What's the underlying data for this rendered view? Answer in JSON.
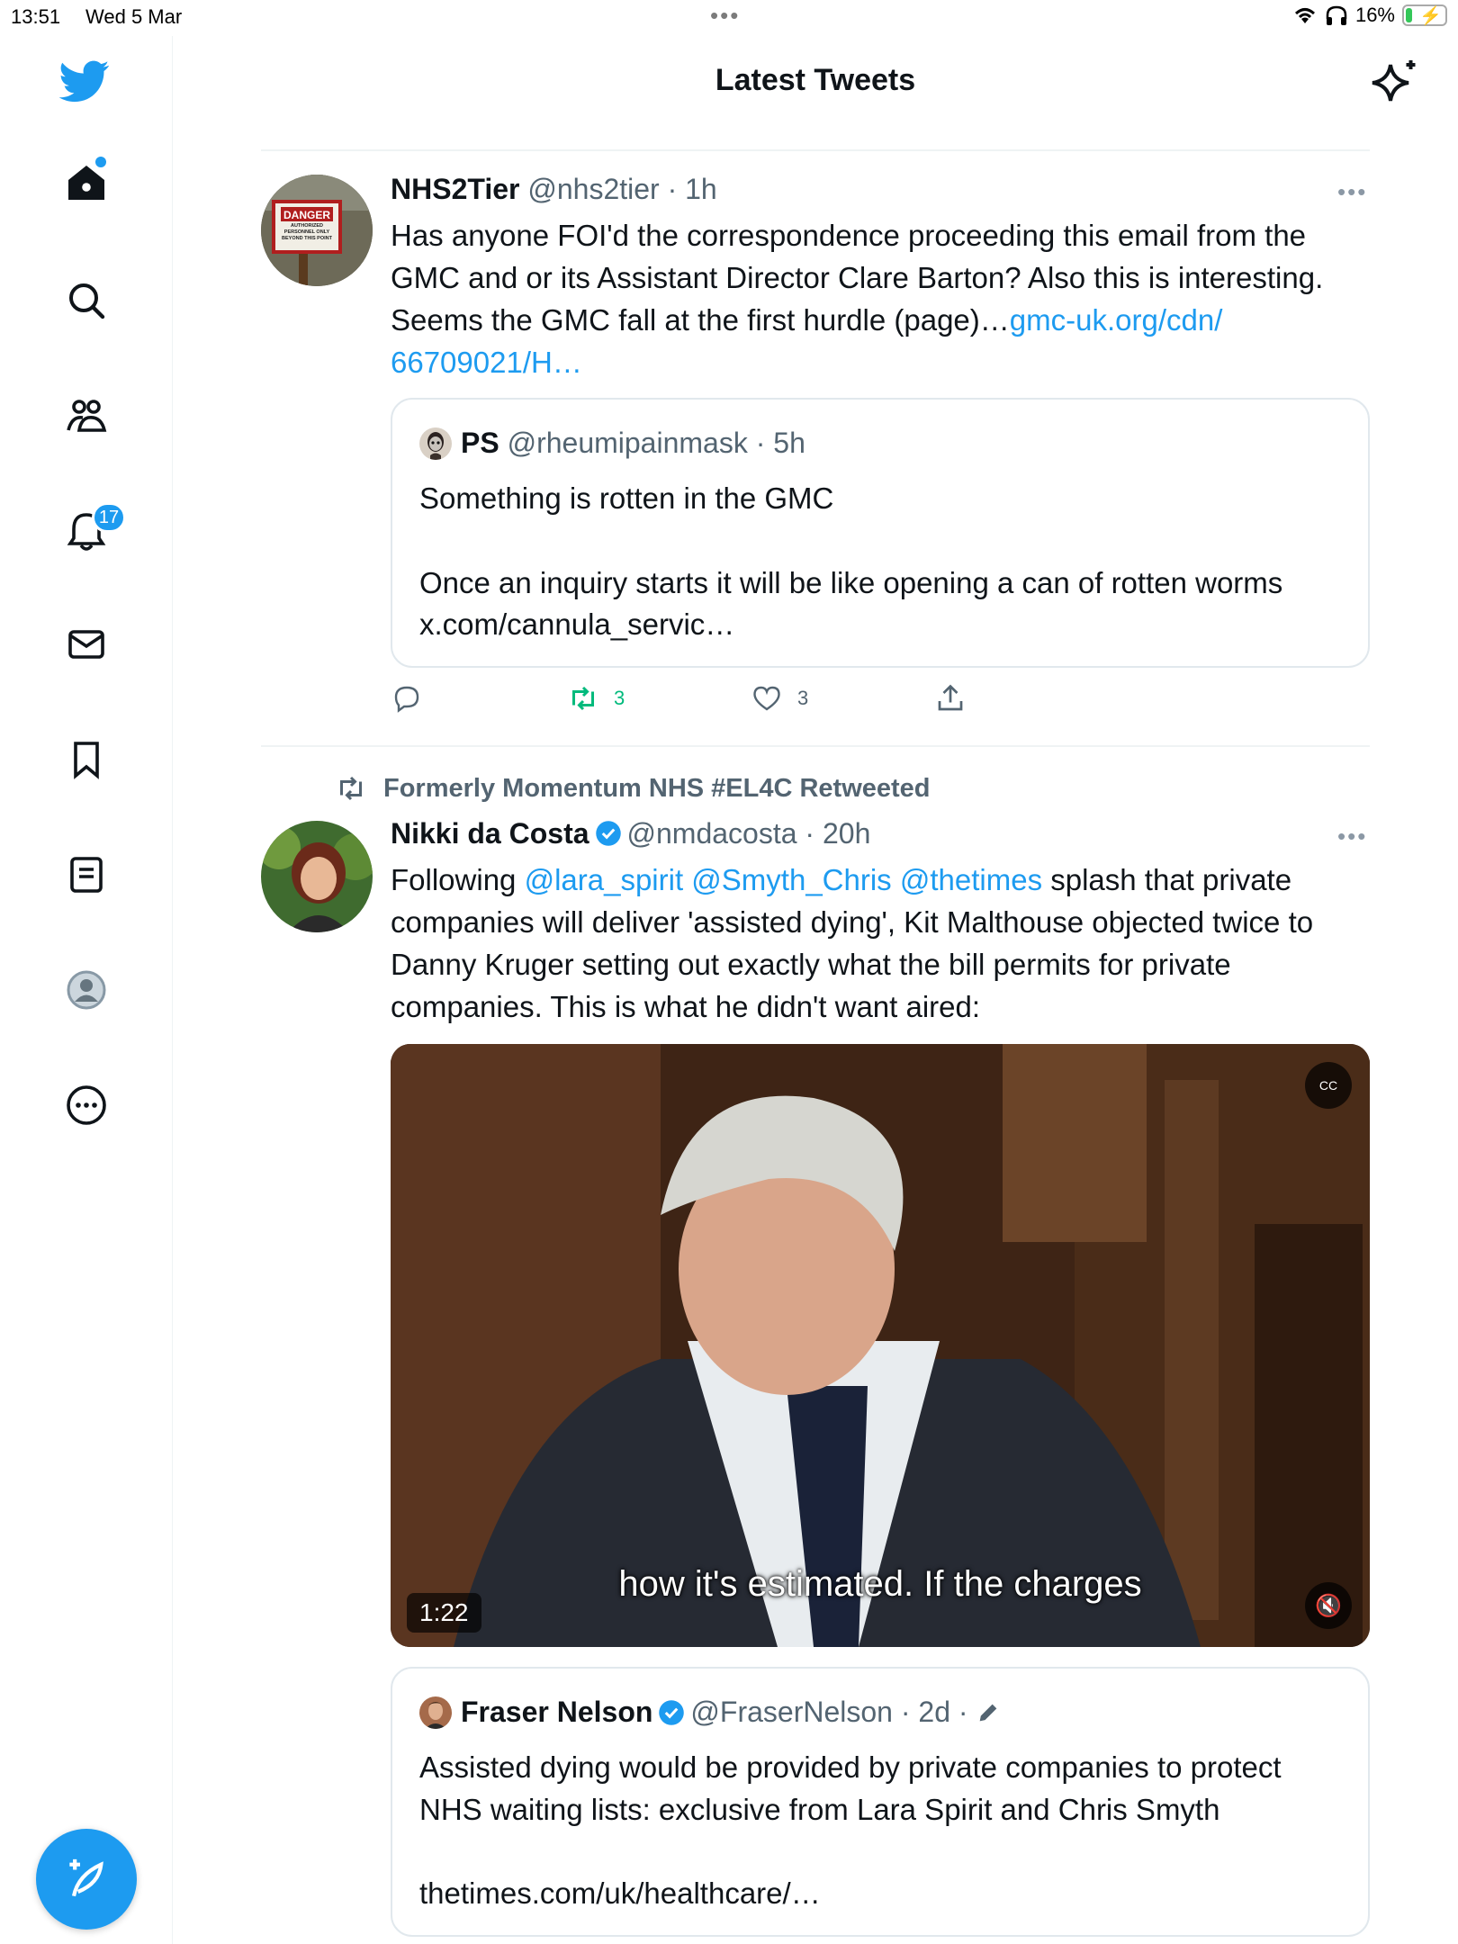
{
  "status_bar": {
    "time": "13:51",
    "date": "Wed 5 Mar",
    "battery": "16%"
  },
  "sidebar": {
    "notifications_badge": "17",
    "items": [
      "home-icon",
      "search-icon",
      "communities-icon",
      "notifications-icon",
      "messages-icon",
      "bookmarks-icon",
      "lists-icon",
      "profile-icon",
      "more-icon"
    ]
  },
  "header": {
    "title": "Latest Tweets"
  },
  "tweets": [
    {
      "name": "NHS2Tier",
      "handle": "@nhs2tier",
      "time": "1h",
      "text": "Has anyone FOI'd the correspondence proceeding this email from the GMC and or its Assistant Director Clare Barton? Also this is interesting. Seems the GMC fall at the first hurdle (page)…",
      "link": "gmc-uk.org/cdn/ 66709021/H…",
      "avatar_sign_word": "DANGER",
      "avatar_sign_text": "AUTHORIZED PERSONNEL ONLY BEYOND THIS POINT",
      "quote": {
        "name": "PS",
        "handle": "@rheumipainmask",
        "time": "5h",
        "line1": "Something is rotten in the GMC",
        "line2": "Once an inquiry starts it will be like opening a can of rotten worms",
        "line3": "x.com/cannula_servic…"
      },
      "retweets": "3",
      "likes": "3"
    },
    {
      "retweeted_by": "Formerly Momentum NHS #EL4C Retweeted",
      "name": "Nikki da Costa",
      "handle": "@nmdacosta",
      "time": "20h",
      "text_before": "Following ",
      "mentions": "@lara_spirit @Smyth_Chris @thetimes",
      "text_after": " splash that private companies will deliver 'assisted dying', Kit Malthouse objected twice to Danny Kruger setting out exactly what the bill permits for private companies. This is what he didn't want aired:",
      "video": {
        "duration": "1:22",
        "subtitle": "how it's estimated. If the charges"
      },
      "quote": {
        "name": "Fraser Nelson",
        "handle": "@FraserNelson",
        "time": "2d",
        "line1": "Assisted dying would be provided by private companies to protect NHS waiting lists: exclusive from Lara Spirit and Chris Smyth",
        "line2": "thetimes.com/uk/healthcare/…"
      }
    }
  ],
  "colors": {
    "accent": "#1d9bf0",
    "retweet_green": "#00ba7c",
    "muted": "#536471"
  }
}
